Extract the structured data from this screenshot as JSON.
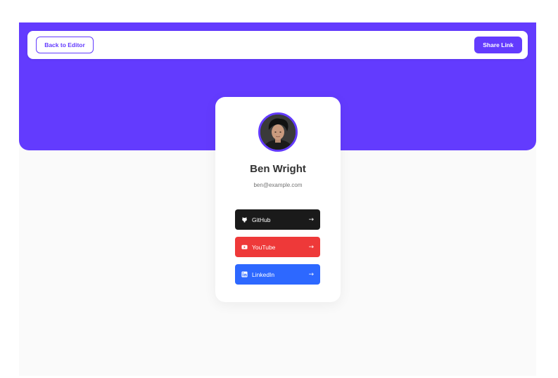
{
  "toolbar": {
    "back_label": "Back to Editor",
    "share_label": "Share Link"
  },
  "profile": {
    "name": "Ben Wright",
    "email": "ben@example.com"
  },
  "links": [
    {
      "label": "GitHub",
      "icon": "github-icon",
      "color": "#1a1a1a",
      "arrow": "→"
    },
    {
      "label": "YouTube",
      "icon": "youtube-icon",
      "color": "#ee3939",
      "arrow": "→"
    },
    {
      "label": "LinkedIn",
      "icon": "linkedin-icon",
      "color": "#2d68ff",
      "arrow": "→"
    }
  ],
  "colors": {
    "accent": "#633bfe",
    "background": "#fafafa"
  }
}
